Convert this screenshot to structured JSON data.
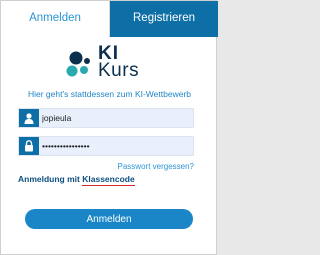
{
  "tabs": {
    "login": "Anmelden",
    "register": "Registrieren"
  },
  "logo": {
    "line1": "KI",
    "line2": "Kurs",
    "color": "#0c2f4e",
    "accent": "#2aa9b0"
  },
  "tagline": "Hier geht's stattdessen zum KI-Wettbewerb",
  "username": {
    "value": "jopieula",
    "icon": "user-icon"
  },
  "password": {
    "value": "••••••••••••••••",
    "icon": "lock-icon"
  },
  "forgot_password": "Passwort vergessen?",
  "class_login": {
    "prefix": "Anmeldung mit ",
    "highlight": "Klassencode"
  },
  "submit_label": "Anmelden",
  "colors": {
    "primary": "#0e6fa6",
    "link": "#2b95d6",
    "button": "#1a86c7",
    "underline": "#d42a2a"
  }
}
